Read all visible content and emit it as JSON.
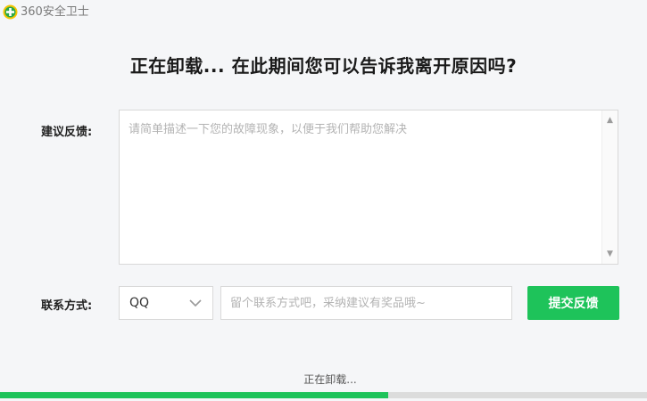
{
  "app": {
    "title": "360安全卫士",
    "logo_icon": "shield-plus-logo"
  },
  "headline": "正在卸载... 在此期间您可以告诉我离开原因吗?",
  "feedback": {
    "label": "建议反馈:",
    "placeholder": "请简单描述一下您的故障现象，以便于我们帮助您解决",
    "value": ""
  },
  "contact": {
    "label": "联系方式:",
    "type_selected": "QQ",
    "placeholder": "留个联系方式吧，采纳建议有奖品哦~",
    "value": ""
  },
  "submit_label": "提交反馈",
  "status": "正在卸载...",
  "progress": 0.6,
  "colors": {
    "accent": "#1ec35a",
    "logo_ring": "#f5c400"
  }
}
